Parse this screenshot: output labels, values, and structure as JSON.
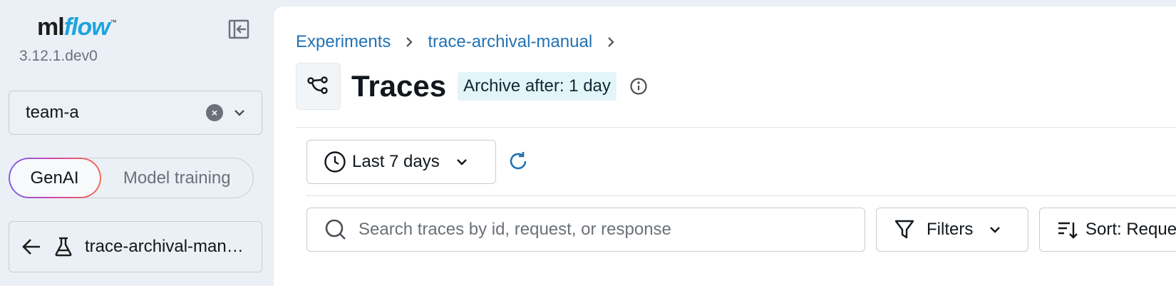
{
  "app": {
    "logo_ml": "ml",
    "logo_flow": "flow",
    "logo_tm": "™",
    "version": "3.12.1.dev0"
  },
  "sidebar": {
    "workspace_value": "team-a",
    "mode_genai": "GenAI",
    "mode_model": "Model training",
    "experiment_name": "trace-archival-manual"
  },
  "breadcrumb": {
    "items": [
      "Experiments",
      "trace-archival-manual"
    ]
  },
  "header": {
    "title": "Traces",
    "archive_badge": "Archive after: 1 day"
  },
  "toolbar": {
    "date_range": "Last 7 days",
    "search_placeholder": "Search traces by id, request, or response",
    "filters_label": "Filters",
    "sort_label": "Sort: Reque"
  },
  "colors": {
    "accent": "#2272b4",
    "logo_flow": "#1ea4dd",
    "badge_bg": "#e2f5f8",
    "sidebar_bg": "#eaf0f5"
  },
  "icons": [
    "collapse-sidebar-icon",
    "clear-icon",
    "chevron-down-icon",
    "arrow-left-icon",
    "flask-icon",
    "chevron-right-icon",
    "traces-icon",
    "info-icon",
    "clock-icon",
    "refresh-icon",
    "search-icon",
    "filter-icon",
    "sort-icon"
  ]
}
